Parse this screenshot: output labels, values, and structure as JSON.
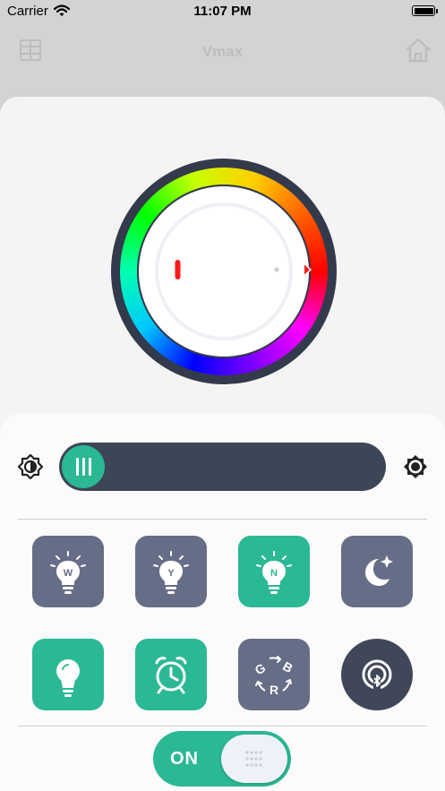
{
  "status_bar": {
    "carrier": "Carrier",
    "time": "11:07 PM",
    "battery_level": 1.0
  },
  "nav": {
    "title": "Vmax",
    "menu_icon": "grid-icon",
    "home_icon": "home-icon"
  },
  "color_wheel": {
    "selected_hue_degrees": 0,
    "indicator_color": "#ff1a1a"
  },
  "brightness": {
    "level": 0.05,
    "min_icon": "brightness-low-icon",
    "max_icon": "brightness-high-icon"
  },
  "modes": [
    {
      "label": "W",
      "icon": "bulb-icon",
      "active": false
    },
    {
      "label": "Y",
      "icon": "bulb-icon",
      "active": false
    },
    {
      "label": "N",
      "icon": "bulb-icon",
      "active": true
    },
    {
      "label": "",
      "icon": "moon-star-icon",
      "active": false
    }
  ],
  "actions": [
    {
      "icon": "lamp-icon",
      "active": true
    },
    {
      "icon": "alarm-clock-icon",
      "active": true
    },
    {
      "icon": "rgb-cycle-icon",
      "labels": [
        "G",
        "B",
        "R"
      ],
      "active": false
    },
    {
      "icon": "bluetooth-broadcast-icon",
      "active": false
    }
  ],
  "power": {
    "label": "ON",
    "state": true
  },
  "colors": {
    "accent": "#2bb895",
    "slate": "#666e87",
    "dark": "#3d4657"
  }
}
